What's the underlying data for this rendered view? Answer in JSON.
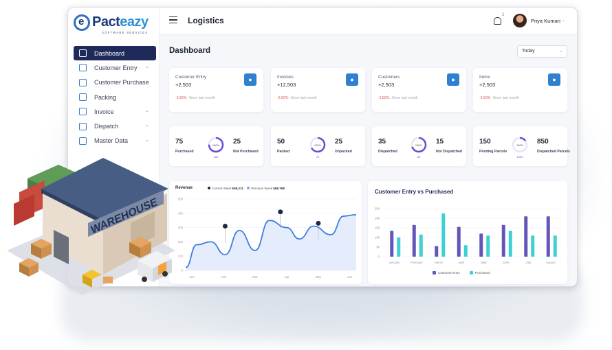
{
  "brand": {
    "logo_initial": "e",
    "logo_name_prefix": "Pact",
    "logo_name_suffix": "eazy",
    "tagline": "SOFTWARE SERVICES"
  },
  "sidebar": {
    "items": [
      {
        "label": "Dashboard",
        "icon": "dashboard-icon",
        "active": true
      },
      {
        "label": "Customer Entry",
        "icon": "user-plus-icon",
        "chevron": "⌄"
      },
      {
        "label": "Customer Purchase",
        "icon": "cart-icon"
      },
      {
        "label": "Packing",
        "icon": "gift-box-icon"
      },
      {
        "label": "Invoice",
        "icon": "invoice-icon",
        "chevron": "⌄"
      },
      {
        "label": "Dispatch",
        "icon": "truck-icon",
        "chevron": "⌄"
      },
      {
        "label": "Master Data",
        "icon": "database-icon",
        "chevron": "⌄"
      }
    ]
  },
  "topbar": {
    "title": "Logistics",
    "notification_count": "2",
    "user_name": "Priya Kumari",
    "user_chevron": "⌄"
  },
  "dashboard": {
    "title": "Dashboard",
    "period": {
      "selected": "Today",
      "chevron": "⌄"
    }
  },
  "stats": [
    {
      "label": "Customer Entry",
      "value": "+2,503",
      "change": "-2.82%",
      "since": "Since last month",
      "icon": "walking-person-icon"
    },
    {
      "label": "Invoices",
      "value": "+12,503",
      "change": "-2.82%",
      "since": "Since last month",
      "icon": "document-icon"
    },
    {
      "label": "Customers",
      "value": "+2,503",
      "change": "-2.82%",
      "since": "Since last month",
      "icon": "person-running-icon"
    },
    {
      "label": "Items",
      "value": "+2,503",
      "change": "-2.60%",
      "since": "Since last month",
      "icon": "shirt-icon"
    }
  ],
  "kpis": [
    {
      "left_value": "75",
      "left_label": "Purchased",
      "ring_label": "100%",
      "ring_foot": "100",
      "right_value": "25",
      "right_label": "Not Purchased",
      "percent": 0.75
    },
    {
      "left_value": "50",
      "left_label": "Packed",
      "ring_label": "100%",
      "ring_foot": "75",
      "right_value": "25",
      "right_label": "Unpacked",
      "percent": 0.67
    },
    {
      "left_value": "35",
      "left_label": "Dispatched",
      "ring_label": "100%",
      "ring_foot": "50",
      "right_value": "15",
      "right_label": "Not Dispatched",
      "percent": 0.7
    },
    {
      "left_value": "150",
      "left_label": "Pending Parcels",
      "ring_label": "100%",
      "ring_foot": "1000",
      "right_value": "850",
      "right_label": "Dispatched Parcels",
      "percent": 0.15
    }
  ],
  "revenue": {
    "title": "Revenue",
    "current_label": "Current Week",
    "current_value": "$58,211",
    "previous_label": "Previous Week",
    "previous_value": "$68,768",
    "colors": {
      "current": "#1d2433",
      "previous": "#7fa7e0",
      "line": "#3d7be0",
      "fill": "#dfe9fb"
    }
  },
  "customer_vs_purchased": {
    "title": "Customer Entry vs Purchased",
    "legend": [
      {
        "label": "Customer Entry",
        "color": "#6356b8"
      },
      {
        "label": "Purchased",
        "color": "#3fd0d4"
      }
    ]
  },
  "chart_data": [
    {
      "type": "area",
      "title": "Revenue",
      "categories": [
        "Jan",
        "Feb",
        "Mar",
        "Apr",
        "May",
        "Jun"
      ],
      "yticks": [
        "50k",
        "40k",
        "30k",
        "20k",
        "10k",
        "0"
      ],
      "ylim": [
        0,
        50
      ],
      "series": [
        {
          "name": "Revenue",
          "x": [
            0,
            0.35,
            0.8,
            1.25,
            1.7,
            2.2,
            2.65,
            3.2,
            3.6,
            4.05,
            4.6,
            5.0,
            5.4
          ],
          "values": [
            2,
            18,
            20,
            11,
            28,
            14,
            35,
            30,
            22,
            31,
            25,
            38,
            39
          ]
        }
      ],
      "markers": [
        {
          "x": 1.25,
          "y": 31
        },
        {
          "x": 3.0,
          "y": 41
        },
        {
          "x": 4.2,
          "y": 33
        }
      ]
    },
    {
      "type": "bar",
      "title": "Customer Entry vs Purchased",
      "categories": [
        "January",
        "February",
        "March",
        "April",
        "May",
        "June",
        "July",
        "August"
      ],
      "yticks": [
        "25k",
        "20k",
        "15k",
        "10k",
        "5k",
        "0"
      ],
      "ylim": [
        0,
        25
      ],
      "series": [
        {
          "name": "Customer Entry",
          "values": [
            13.5,
            16.5,
            5.5,
            15.5,
            12,
            16.5,
            21,
            21
          ]
        },
        {
          "name": "Purchased",
          "values": [
            10,
            11.5,
            22.5,
            6,
            11,
            13.5,
            11,
            11
          ]
        }
      ]
    }
  ]
}
